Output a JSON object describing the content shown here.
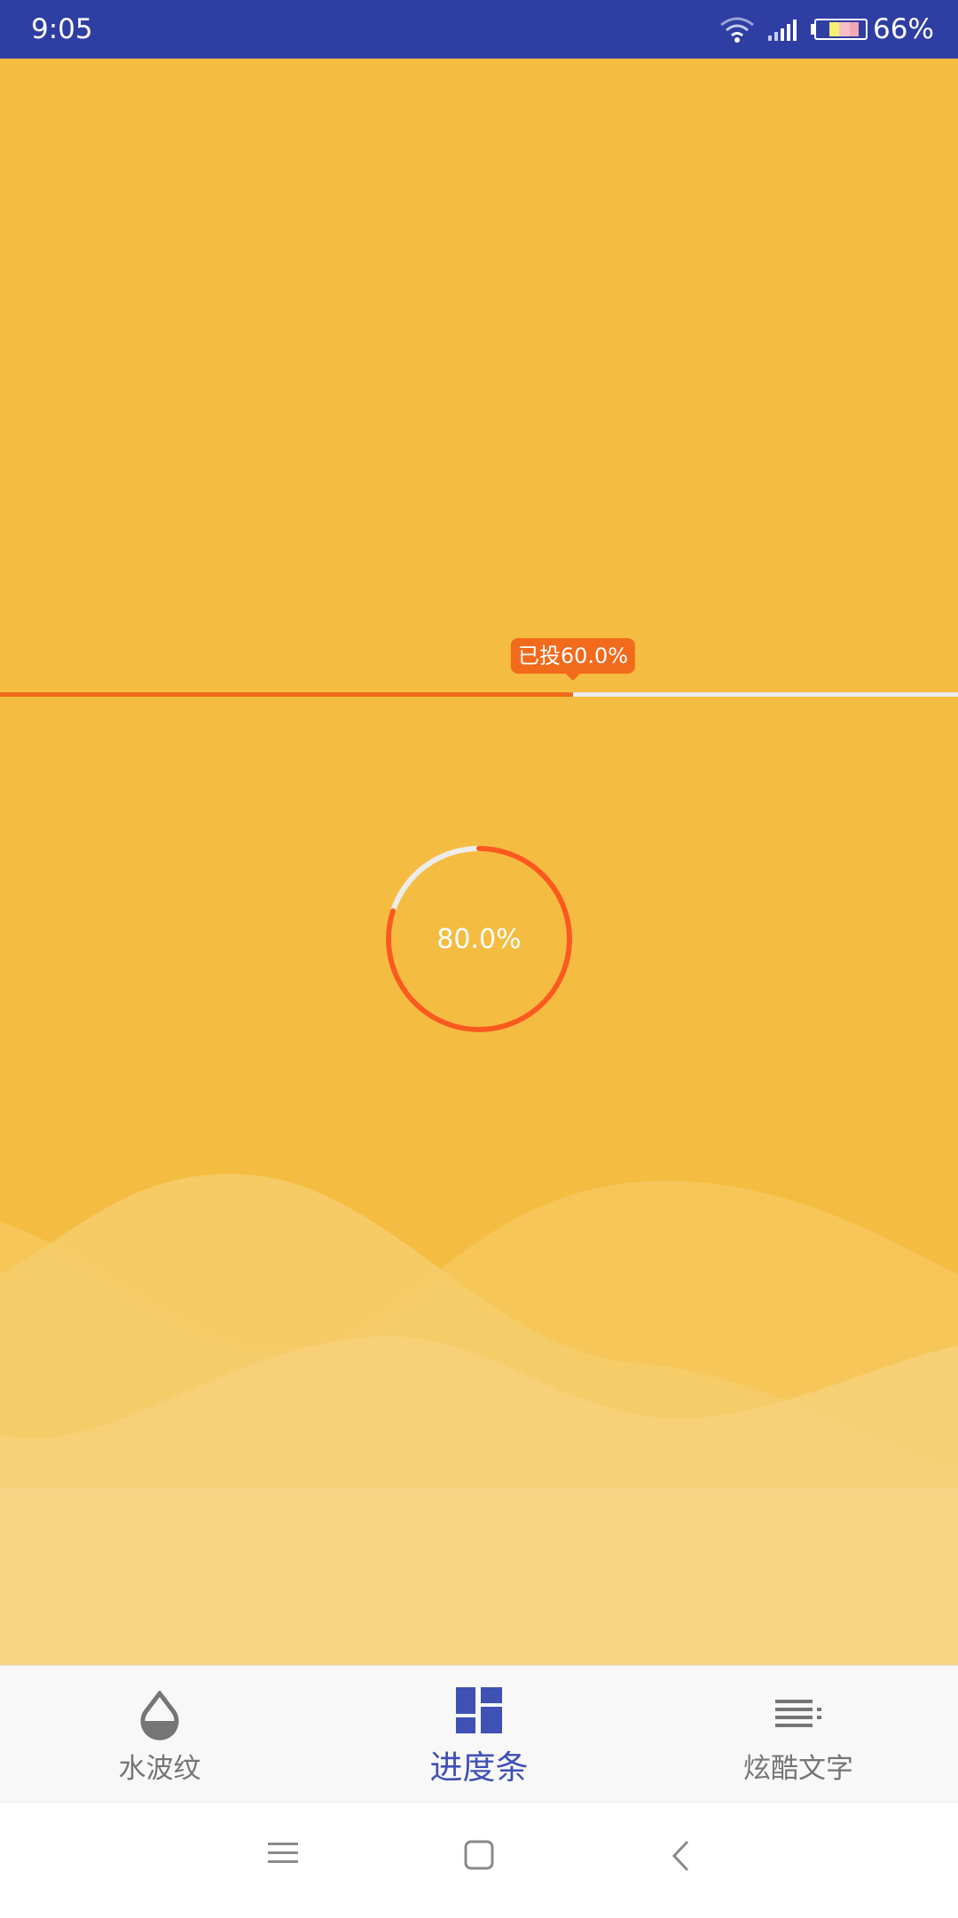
{
  "status_bar": {
    "time": "9:05",
    "battery_percent": "66%",
    "icons": [
      "wifi-icon",
      "signal-icon",
      "battery-icon"
    ],
    "background": "#2f3ea3"
  },
  "main": {
    "background": "#f4bd41",
    "linear_progress": {
      "tooltip": "已投60.0%",
      "progress": 0.6,
      "fill_color": "#f26a1b",
      "track_color": "#ececec"
    },
    "circular_progress": {
      "label": "80.0%",
      "progress": 0.8,
      "arc_color": "#fb5a1c",
      "track_color": "#ececec"
    }
  },
  "bottom_nav": {
    "items": [
      {
        "label": "水波纹",
        "icon": "water-drop-icon",
        "active": false
      },
      {
        "label": "进度条",
        "icon": "dashboard-icon",
        "active": true
      },
      {
        "label": "炫酷文字",
        "icon": "list-icon",
        "active": false
      }
    ],
    "active_color": "#3f51b5",
    "inactive_color": "#757575"
  },
  "system_nav": {
    "buttons": [
      "menu-icon",
      "home-icon",
      "back-icon"
    ]
  }
}
